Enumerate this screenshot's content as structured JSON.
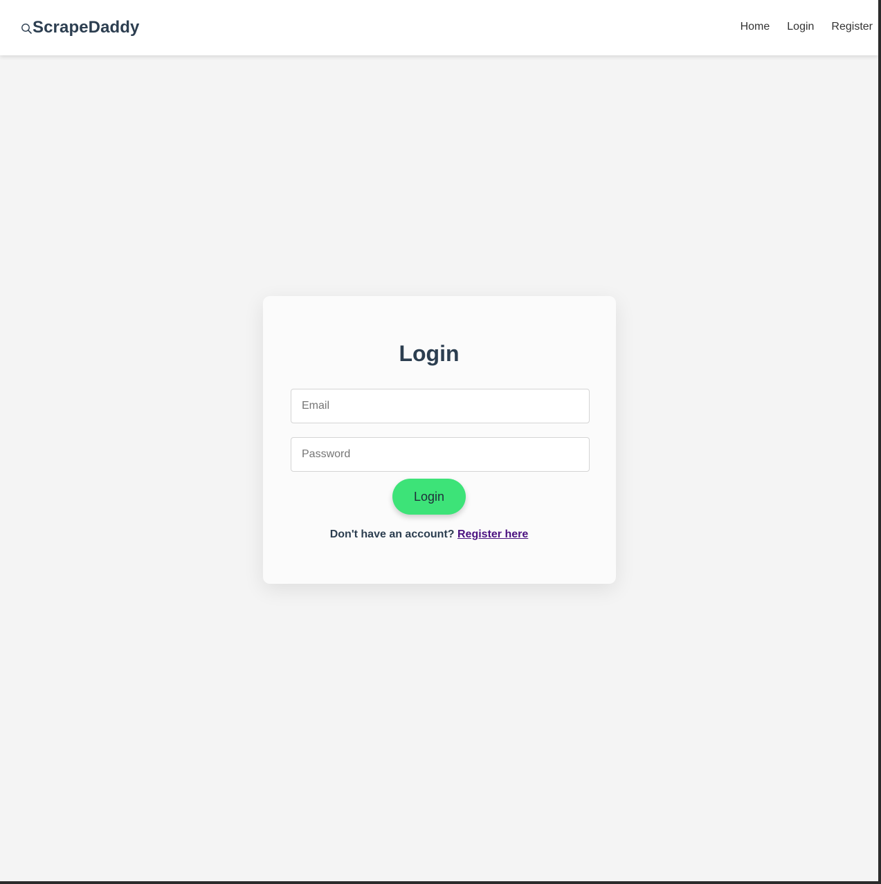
{
  "navbar": {
    "brand_icon": "search-icon",
    "brand": "ScrapeDaddy",
    "links": [
      {
        "label": "Home"
      },
      {
        "label": "Login"
      },
      {
        "label": "Register"
      }
    ]
  },
  "login_card": {
    "title": "Login",
    "email_placeholder": "Email",
    "email_value": "",
    "password_placeholder": "Password",
    "password_value": "",
    "submit_label": "Login",
    "register_prompt": "Don't have an account?",
    "register_link_label": "Register here"
  },
  "colors": {
    "page_background": "#f4f4f4",
    "navbar_background": "#ffffff",
    "card_background": "#fbfbfb",
    "heading_text": "#2c3e50",
    "button_green": "#3de378",
    "link_purple": "#4b1180"
  }
}
